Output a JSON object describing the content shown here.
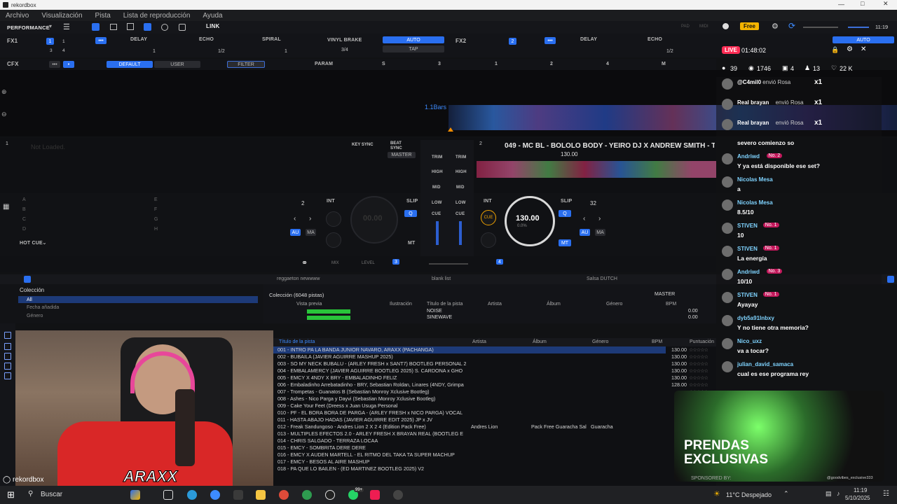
{
  "window": {
    "title": "rekordbox"
  },
  "menu": [
    "Archivo",
    "Visualización",
    "Pista",
    "Lista de reproducción",
    "Ayuda"
  ],
  "toolbar": {
    "mode": "PERFORMANCE",
    "link": "LINK",
    "free_badge": "Free",
    "clock": "11:19",
    "pad": "PAD",
    "midi": "MIDI"
  },
  "fx1": {
    "label": "FX1",
    "effects": [
      "DELAY",
      "ECHO",
      "SPIRAL"
    ],
    "vinyl_brake": "VINYL BRAKE",
    "auto": "AUTO",
    "tap": "TAP",
    "beats": [
      "1",
      "1/2",
      "1",
      "3/4"
    ],
    "numbers": [
      "1",
      "2",
      "3",
      "3",
      "4",
      "M"
    ]
  },
  "fx2": {
    "label": "FX2",
    "effects": [
      "DELAY",
      "ECHO",
      "SPIRAL"
    ],
    "beats": [
      "1",
      "1/2",
      "3/4"
    ],
    "auto": "AUTO"
  },
  "cfx": {
    "label": "CFX",
    "default": "DEFAULT",
    "user": "USER",
    "filter": "FILTER",
    "param": "PARAM",
    "knob_labels": [
      "S",
      "3",
      "1",
      "2",
      "4",
      "M"
    ]
  },
  "waveform": {
    "bars_label": "1.1Bars"
  },
  "deck1": {
    "number": "1",
    "status": "Not Loaded.",
    "time": "00:00:0 00:00:0",
    "key_sync": "KEY SYNC",
    "beat_sync": "BEAT SYNC",
    "master": "MASTER",
    "loop": "2",
    "bpm": "00.00",
    "au": "AU",
    "ma": "MA",
    "int": "INT",
    "slip": "SLIP",
    "q": "Q",
    "mt": "MT",
    "hot_cue": "HOT CUE",
    "pads": [
      "A",
      "B",
      "C",
      "D",
      "E",
      "F",
      "G",
      "H"
    ]
  },
  "deck2": {
    "number": "2",
    "title": "049 - MC BL - BOLOLO BODY - YEIRO DJ X ANDREW SMITH - TREND...",
    "bpm_small": "130.00",
    "time": "-03:42.9",
    "bpm": "130.00",
    "pitch": "0.0%",
    "pitch_range": "±16",
    "cue": "CUE",
    "int": "INT",
    "slip": "SLIP",
    "q": "Q",
    "au": "AU",
    "ma": "MA",
    "mt": "MT",
    "loop": "32",
    "hot_cue": "HOT CUE",
    "key_sync": "KEY SYNC",
    "beat_sync": "BEAT SYNC",
    "master": "MASTER"
  },
  "mixer": {
    "trim": "TRIM",
    "high": "HIGH",
    "mid": "MID",
    "low": "LOW",
    "cue": "CUE",
    "mix": "MIX",
    "level": "LEVEL"
  },
  "browser": {
    "tabs": [
      "reggaeton newwww",
      "blank list",
      "Salsa DUTCH"
    ],
    "collection_title": "Colección",
    "collection_count": "Colección (6048 pistas)",
    "tree": [
      "All",
      "Fecha añadida",
      "Género"
    ],
    "master": "MASTER",
    "preview_columns": [
      "Vista previa",
      "Ilustración",
      "Título de la pista",
      "Artista",
      "Álbum",
      "Género",
      "BPM",
      "Puntuación"
    ],
    "preview_rows": [
      {
        "title": "NOISE",
        "bpm": "0.00"
      },
      {
        "title": "SINEWAVE",
        "bpm": "0.00"
      }
    ],
    "columns": [
      "Título de la pista",
      "Artista",
      "Álbum",
      "Género",
      "BPM",
      "Puntuación",
      "Tonalidad",
      "Fecha añadida"
    ],
    "tracks": [
      {
        "title": "001 - INTRO PA LA BANDA JUNIOR NAVARO, ARAXX (PACHANGA)",
        "artist": "",
        "album": "",
        "genre": "",
        "bpm": "130.00",
        "date": "20/09/2025"
      },
      {
        "title": "002 - BUBAILA (JAVIER AGUIRRE MASHUP 2025)",
        "artist": "",
        "album": "",
        "genre": "",
        "bpm": "130.00",
        "date": "20/09/2025"
      },
      {
        "title": "003 - SO MY NECK BUBALU - (ARLEY FRESH x SANT7) BOOTLEG PERSONAL 2",
        "artist": "",
        "album": "",
        "genre": "",
        "bpm": "130.00",
        "date": "20/09/2025"
      },
      {
        "title": "004 - EMBALAMERCY (JAVIER AGUIRRE BOOTLEG 2025) S. CARDONA x GHO",
        "artist": "",
        "album": "",
        "genre": "",
        "bpm": "130.00",
        "date": "20/09/2025"
      },
      {
        "title": "005 - EMCY X 4NDY X BRY - EMBALADINHO FELIZ",
        "artist": "",
        "album": "",
        "genre": "",
        "bpm": "130.00",
        "date": "20/09/2025"
      },
      {
        "title": "006 - Embaladinho Arrebatadinho - BRY, Sebastian Roldan, Linares (4NDY, Grimpa",
        "artist": "",
        "album": "",
        "genre": "",
        "bpm": "128.00",
        "date": "20/09/2025"
      },
      {
        "title": "007 - Trompetas - Guanatos B (Sebastian Monroy Xclusive Bootleg)",
        "artist": "",
        "album": "",
        "genre": "",
        "bpm": "",
        "date": ""
      },
      {
        "title": "008 - Ashes - Nico Parga y Dayvi (Sebastian Monroy Xclusive Bootleg)",
        "artist": "",
        "album": "",
        "genre": "",
        "bpm": "",
        "date": ""
      },
      {
        "title": "009 - Cake Your Feet (Dreess x Juan Usuga Personal",
        "artist": "",
        "album": "",
        "genre": "",
        "bpm": "",
        "date": ""
      },
      {
        "title": "010 - PF - EL BORA BORA DE PARGA - (ARLEY FRESH x NICO PARGA) VOCAL",
        "artist": "",
        "album": "",
        "genre": "",
        "bpm": "",
        "date": ""
      },
      {
        "title": "011 - HASTA ABAJO HADAS (JAVIER AGUIRRE EDIT 2025) JP x JV",
        "artist": "",
        "album": "",
        "genre": "",
        "bpm": "",
        "date": ""
      },
      {
        "title": "012 - Freak Sandungoso - Andres Lion 2 X 2 4 (Edition Pack Free)",
        "artist": "Andres Lion",
        "album": "Pack Free Guaracha Sal",
        "genre": "Guaracha",
        "bpm": "",
        "date": ""
      },
      {
        "title": "013 - MULTIPLES EFECTOS 2.0 - ARLEY FRESH X BRAYAN REAL (BOOTLEG E",
        "artist": "",
        "album": "",
        "genre": "",
        "bpm": "",
        "date": ""
      },
      {
        "title": "014 - CHRIS SALGADO - TERRAZA LOCAA",
        "artist": "",
        "album": "",
        "genre": "",
        "bpm": "",
        "date": ""
      },
      {
        "title": "015 - EMCY - SOMBRITA DERE DERE",
        "artist": "",
        "album": "",
        "genre": "",
        "bpm": "",
        "date": ""
      },
      {
        "title": "016 - EMCY X AUDEN MARTELL - EL RITMO DEL TAKA TA SUPER MACHUP",
        "artist": "",
        "album": "",
        "genre": "",
        "bpm": "",
        "date": ""
      },
      {
        "title": "017 - EMCY - BESOS AL AIRE MASHUP",
        "artist": "",
        "album": "",
        "genre": "",
        "bpm": "",
        "date": ""
      },
      {
        "title": "018 - PA QUE LO BAILEN - (ED MARTINEZ BOOTLEG 2025) V2",
        "artist": "",
        "album": "",
        "genre": "",
        "bpm": "",
        "date": ""
      }
    ]
  },
  "stream": {
    "live_label": "LIVE",
    "elapsed": "01:48:02",
    "stats": {
      "viewers": "39",
      "views": "1746",
      "gifts": "4",
      "members": "13",
      "likes": "22 K"
    },
    "messages": [
      {
        "user": "@C4mil0",
        "text": "envió Rosa",
        "gift": "x1"
      },
      {
        "user": "Real brayan",
        "text": "envió Rosa",
        "gift": "x1"
      },
      {
        "user": "Real brayan",
        "text": "envió Rosa",
        "gift": "x1"
      },
      {
        "user": "",
        "text": "severo comienzo so"
      },
      {
        "user": "Andriwd",
        "badge": "No. 2",
        "text": "Y ya está disponible ese set?"
      },
      {
        "user": "Nicolas Mesa",
        "text": "a"
      },
      {
        "user": "Nicolas Mesa",
        "text": "8.5/10"
      },
      {
        "user": "STIVEN",
        "badge": "No. 1",
        "text": "10"
      },
      {
        "user": "STIVEN",
        "badge": "No. 1",
        "text": "La energía"
      },
      {
        "user": "Andriwd",
        "badge": "No. 3",
        "text": "10/10"
      },
      {
        "user": "STIVEN",
        "badge": "No. 1",
        "text": "Ayayay"
      },
      {
        "user": "dyb5a91lnbxy",
        "text": "Y no tiene otra memoria?"
      },
      {
        "user": "Nico_uxz",
        "text": "va a tocar?"
      },
      {
        "user": "julian_david_samaca",
        "text": "cual es ese programa rey"
      }
    ],
    "promo": {
      "line1": "PRENDAS",
      "line2": "EXCLUSIVAS",
      "sponsored": "SPONSORED BY:",
      "handle": "@goodvibes_exclusive333"
    },
    "streamer_logo": "ARAXX"
  },
  "brand": {
    "name": "rekordbox"
  },
  "taskbar": {
    "search": "Buscar",
    "weather": "11°C Despejado",
    "time": "11:19",
    "date": "5/10/2025",
    "badge": "99+"
  },
  "colors": {
    "accent": "#2a6ff0",
    "live": "#ff2d55",
    "chat_user": "#7fd3ff",
    "waveform": "#3d8bff"
  }
}
